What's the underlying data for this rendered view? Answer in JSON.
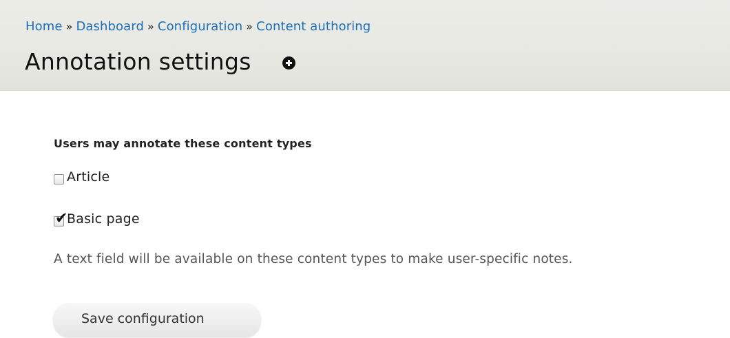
{
  "breadcrumb": {
    "items": [
      {
        "label": "Home"
      },
      {
        "label": "Dashboard"
      },
      {
        "label": "Configuration"
      },
      {
        "label": "Content authoring"
      }
    ],
    "separator": "»"
  },
  "header": {
    "title": "Annotation settings",
    "shortcut_icon": "add-shortcut-icon"
  },
  "form": {
    "fieldset_label": "Users may annotate these content types",
    "options": [
      {
        "label": "Article",
        "checked": false
      },
      {
        "label": "Basic page",
        "checked": true
      }
    ],
    "description": "A text field will be available on these content types to make user-specific notes.",
    "submit_label": "Save configuration"
  },
  "colors": {
    "link": "#1b6fb5",
    "header_bg": "#e6e6e1"
  }
}
